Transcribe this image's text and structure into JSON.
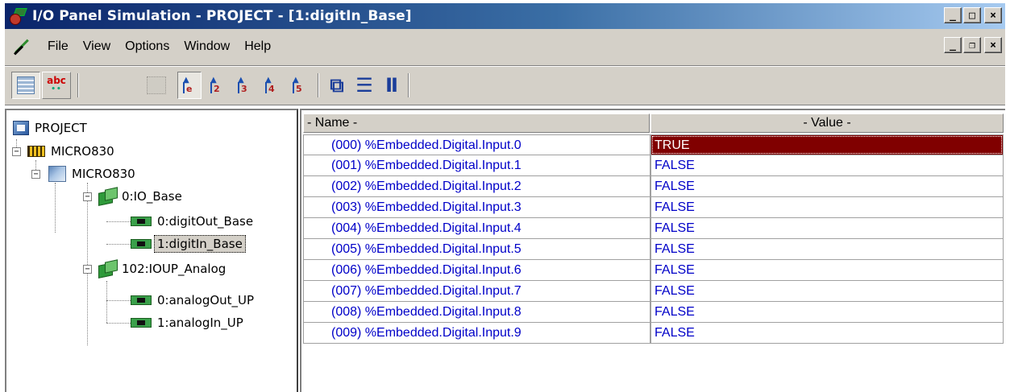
{
  "window": {
    "title": "I/O Panel Simulation - PROJECT - [1:digitIn_Base]",
    "controls": {
      "minimize": "_",
      "maximize": "□",
      "close": "×"
    }
  },
  "menubar": {
    "items": [
      "File",
      "View",
      "Options",
      "Window",
      "Help"
    ],
    "mdi_controls": {
      "minimize": "_",
      "restore": "❐",
      "close": "×"
    }
  },
  "toolbar": {
    "abc_label": "abc",
    "num_buttons": [
      "e",
      "2",
      "3",
      "4",
      "5"
    ]
  },
  "tree": {
    "nodes": [
      {
        "label": "PROJECT",
        "icon": "project-icon"
      },
      {
        "label": "MICRO830",
        "icon": "controller-icon"
      },
      {
        "label": "MICRO830",
        "icon": "cpu-icon"
      },
      {
        "label": "0:IO_Base",
        "icon": "module-icon"
      },
      {
        "label": "0:digitOut_Base",
        "icon": "io-card-icon"
      },
      {
        "label": "1:digitIn_Base",
        "icon": "io-card-icon",
        "selected": true
      },
      {
        "label": "102:IOUP_Analog",
        "icon": "module-icon"
      },
      {
        "label": "0:analogOut_UP",
        "icon": "io-card-icon"
      },
      {
        "label": "1:analogIn_UP",
        "icon": "io-card-icon"
      }
    ]
  },
  "grid": {
    "columns": {
      "name": "- Name -",
      "value": "- Value -"
    },
    "rows": [
      {
        "name": "(000) %Embedded.Digital.Input.0",
        "value": "TRUE"
      },
      {
        "name": "(001) %Embedded.Digital.Input.1",
        "value": "FALSE"
      },
      {
        "name": "(002) %Embedded.Digital.Input.2",
        "value": "FALSE"
      },
      {
        "name": "(003) %Embedded.Digital.Input.3",
        "value": "FALSE"
      },
      {
        "name": "(004) %Embedded.Digital.Input.4",
        "value": "FALSE"
      },
      {
        "name": "(005) %Embedded.Digital.Input.5",
        "value": "FALSE"
      },
      {
        "name": "(006) %Embedded.Digital.Input.6",
        "value": "FALSE"
      },
      {
        "name": "(007) %Embedded.Digital.Input.7",
        "value": "FALSE"
      },
      {
        "name": "(008) %Embedded.Digital.Input.8",
        "value": "FALSE"
      },
      {
        "name": "(009) %Embedded.Digital.Input.9",
        "value": "FALSE"
      }
    ]
  },
  "colors": {
    "true_cell_bg": "#800000",
    "value_text": "#0000c8",
    "chrome": "#d4d0c8",
    "titlebar_start": "#0a246a",
    "titlebar_end": "#a6caf0"
  }
}
